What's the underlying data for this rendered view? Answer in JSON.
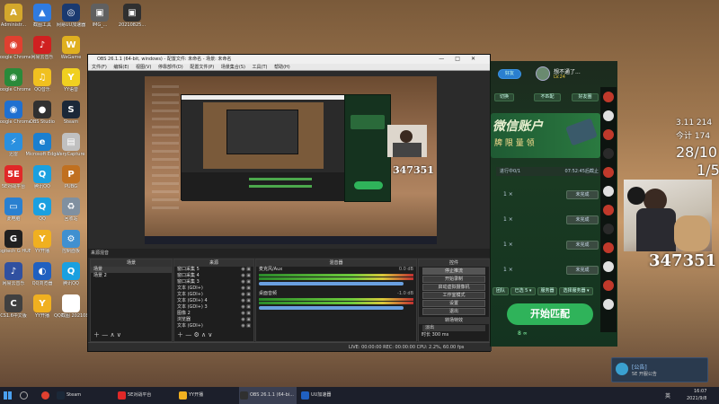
{
  "desktop_icons": [
    {
      "label": "Administr...",
      "color": "#d4a82c",
      "glyph": "A"
    },
    {
      "label": "截图工具",
      "color": "#2f7be0",
      "glyph": "▲"
    },
    {
      "label": "网易UU加速器",
      "color": "#1a3a70",
      "glyph": "◎"
    },
    {
      "label": "IMG_...",
      "color": "#606060",
      "glyph": "▣"
    },
    {
      "label": "20210825...",
      "color": "#303030",
      "glyph": "▣"
    },
    {
      "label": "Google Chrome",
      "color": "#e04030",
      "glyph": "◉"
    },
    {
      "label": "网易云音乐",
      "color": "#d02020",
      "glyph": "♪"
    },
    {
      "label": "WeGame",
      "color": "#e0b020",
      "glyph": "W"
    },
    {
      "label": "Google Chrome",
      "color": "#2a8a3a",
      "glyph": "◉"
    },
    {
      "label": "QQ音乐",
      "color": "#f0c020",
      "glyph": "♫"
    },
    {
      "label": "YY语音",
      "color": "#f0d020",
      "glyph": "Y"
    },
    {
      "label": "Google Chrome",
      "color": "#2070d0",
      "glyph": "◉"
    },
    {
      "label": "OBS Studio",
      "color": "#303030",
      "glyph": "●"
    },
    {
      "label": "Steam",
      "color": "#1b2838",
      "glyph": "S"
    },
    {
      "label": "迅雷",
      "color": "#2a90e0",
      "glyph": "⚡"
    },
    {
      "label": "Microsoft Edge",
      "color": "#1a7fcf",
      "glyph": "e"
    },
    {
      "label": "VeryCapture",
      "color": "#c0c0c0",
      "glyph": "▤"
    },
    {
      "label": "5E对战平台",
      "color": "#e02828",
      "glyph": "5E"
    },
    {
      "label": "腾讯QQ",
      "color": "#1aa0e0",
      "glyph": "Q"
    },
    {
      "label": "PUBG",
      "color": "#c07020",
      "glyph": "P"
    },
    {
      "label": "此电脑",
      "color": "#2a80d0",
      "glyph": "▭"
    },
    {
      "label": "QQ",
      "color": "#1aa0e0",
      "glyph": "Q"
    },
    {
      "label": "回收站",
      "color": "#8090a0",
      "glyph": "♻"
    },
    {
      "label": "Logitech G HUB",
      "color": "#202020",
      "glyph": "G"
    },
    {
      "label": "YY开播",
      "color": "#f0b020",
      "glyph": "Y"
    },
    {
      "label": "控制面板",
      "color": "#4090d0",
      "glyph": "⚙"
    },
    {
      "label": "网易云音乐",
      "color": "#3050a0",
      "glyph": "♪"
    },
    {
      "label": "QQ浏览器",
      "color": "#2060c0",
      "glyph": "◐"
    },
    {
      "label": "腾讯QQ",
      "color": "#1aa0e0",
      "glyph": "Q"
    },
    {
      "label": "CS1.6中文版",
      "color": "#404040",
      "glyph": "C"
    },
    {
      "label": "YY开播",
      "color": "#f0b020",
      "glyph": "Y"
    },
    {
      "label": "QQ截图 20210822...",
      "color": "#ffffff",
      "glyph": ""
    }
  ],
  "obs": {
    "title": "OBS 26.1.1 (64-bit, windows) - 配置文件: 未命名 - 场景: 未命名",
    "window_controls": [
      "—",
      "□",
      "✕"
    ],
    "menu": [
      "文件(F)",
      "编辑(E)",
      "视图(V)",
      "停靠部件(D)",
      "配置文件(P)",
      "场景集合(S)",
      "工具(T)",
      "帮助(H)"
    ],
    "dock_tab": "来源混音",
    "scenes_title": "场景",
    "scenes": [
      "场景",
      "场景 2"
    ],
    "sources_title": "来源",
    "sources": [
      {
        "name": "窗口采集 5"
      },
      {
        "name": "窗口采集 4"
      },
      {
        "name": "窗口采集 3"
      },
      {
        "name": "文本 (GDI+)"
      },
      {
        "name": "文本 (GDI+)"
      },
      {
        "name": "文本 (GDI+) 4"
      },
      {
        "name": "文本 (GDI+) 3"
      },
      {
        "name": "图像 2"
      },
      {
        "name": "浏览器"
      },
      {
        "name": "文本 (GDI+)"
      }
    ],
    "mixer_title": "混音器",
    "mixer": [
      {
        "name": "麦克风/Aux",
        "db": "0.0 dB"
      },
      {
        "name": "桌面音频",
        "db": "-1.0 dB"
      }
    ],
    "controls_title": "控件",
    "controls": [
      "停止推流",
      "开始录制",
      "启动虚拟摄像机",
      "工作室模式",
      "设置",
      "退出"
    ],
    "transitions_title": "转场特效",
    "transition_select": "淡出",
    "duration_label": "时长",
    "duration": "300 ms",
    "status": "LIVE: 00:00:00   REC: 00:00:00   CPU: 2.2%, 60.00 fps"
  },
  "game": {
    "button_top": "好友",
    "username": "想不通了...",
    "level": "LV.24",
    "btn_a": "切换",
    "btn_b": "不匹配",
    "btn_c": "好友圈",
    "banner_line1": "微信账户",
    "banner_line2": "牌 限 量 领",
    "timer_left": "进行中0/1",
    "timer_right": "07:52:45后截止",
    "tasks": [
      {
        "n": "1 ×",
        "btn": "未完成"
      },
      {
        "n": "1 ×",
        "btn": "未完成"
      },
      {
        "n": "1 ×",
        "btn": "未完成"
      },
      {
        "n": "1 ×",
        "btn": "未完成"
      }
    ],
    "mode_a": "团队",
    "mode_b": "已选 5 ▾",
    "mode_c": "服务器",
    "mode_d": "选择服务器 ▾",
    "start": "开始匹配",
    "footer_label": "8 ∞"
  },
  "overlay": {
    "line1": "3.11 214",
    "line2": "今计 174",
    "line3": "28/10",
    "line4": "1/5",
    "score": "347351"
  },
  "notification": {
    "title": "[公告]",
    "body": "5E 开服公告"
  },
  "taskbar": {
    "items": [
      {
        "label": "Steam",
        "color": "#1b2838"
      },
      {
        "label": "5E对战平台",
        "color": "#e02828"
      },
      {
        "label": "YY开播",
        "color": "#f0b020"
      },
      {
        "label": "OBS 26.1.1 (64-bi...",
        "color": "#303030"
      },
      {
        "label": "UU加速器",
        "color": "#2060c0"
      }
    ],
    "tray": "英",
    "time": "16:07",
    "date": "2021/9/8"
  }
}
